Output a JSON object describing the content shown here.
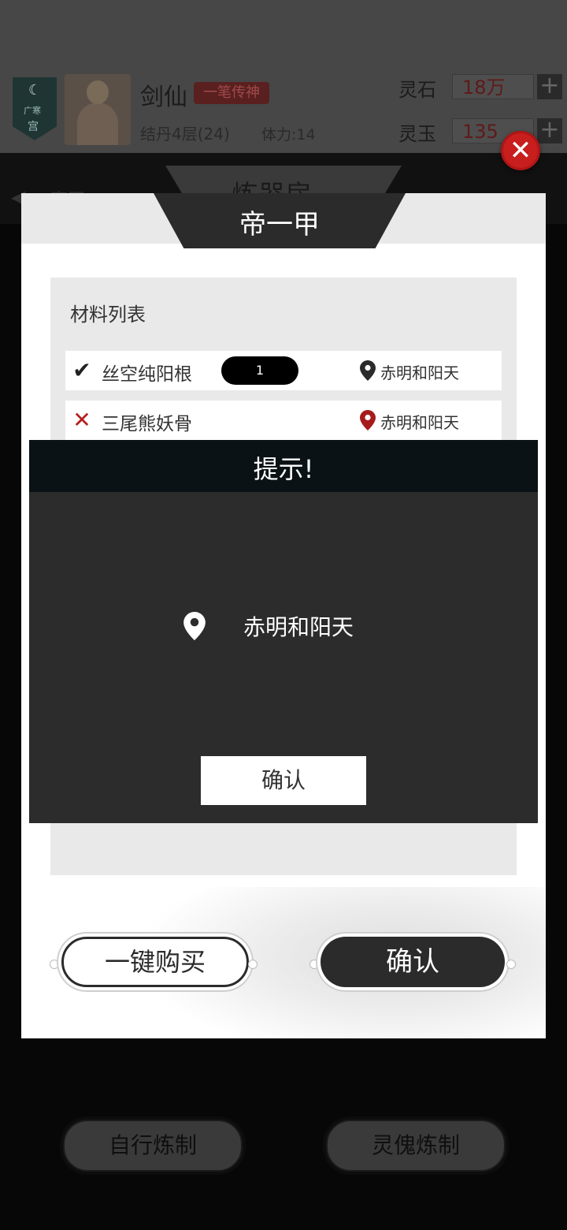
{
  "player": {
    "sect_name": "广寒",
    "sect_suffix": "宫",
    "name": "剑仙",
    "title": "一笔传神",
    "realm": "结丹4层(24)",
    "stamina": "体力:14"
  },
  "currencies": [
    {
      "label": "灵石",
      "value": "18万"
    },
    {
      "label": "灵玉",
      "value": "135"
    }
  ],
  "nav": {
    "back_label": "离开",
    "hall_title": "炼器房"
  },
  "bottom_buttons": {
    "self_refine": "自行炼制",
    "puppet_refine": "灵傀炼制"
  },
  "panel": {
    "title": "帝一甲",
    "list_heading": "材料列表",
    "materials": [
      {
        "name": "丝空纯阳根",
        "status": "owned",
        "qty": "1",
        "location": "赤明和阳天"
      },
      {
        "name": "三尾熊妖骨",
        "status": "missing",
        "qty": "",
        "location": "赤明和阳天"
      }
    ],
    "buy_all_label": "一键购买",
    "confirm_label": "确认"
  },
  "hint_dialog": {
    "title": "提示!",
    "location": "赤明和阳天",
    "confirm_label": "确认"
  },
  "colors": {
    "accent_red": "#c81e1e",
    "dark": "#2b2b2b",
    "panel_gray": "#e9e9e9"
  }
}
